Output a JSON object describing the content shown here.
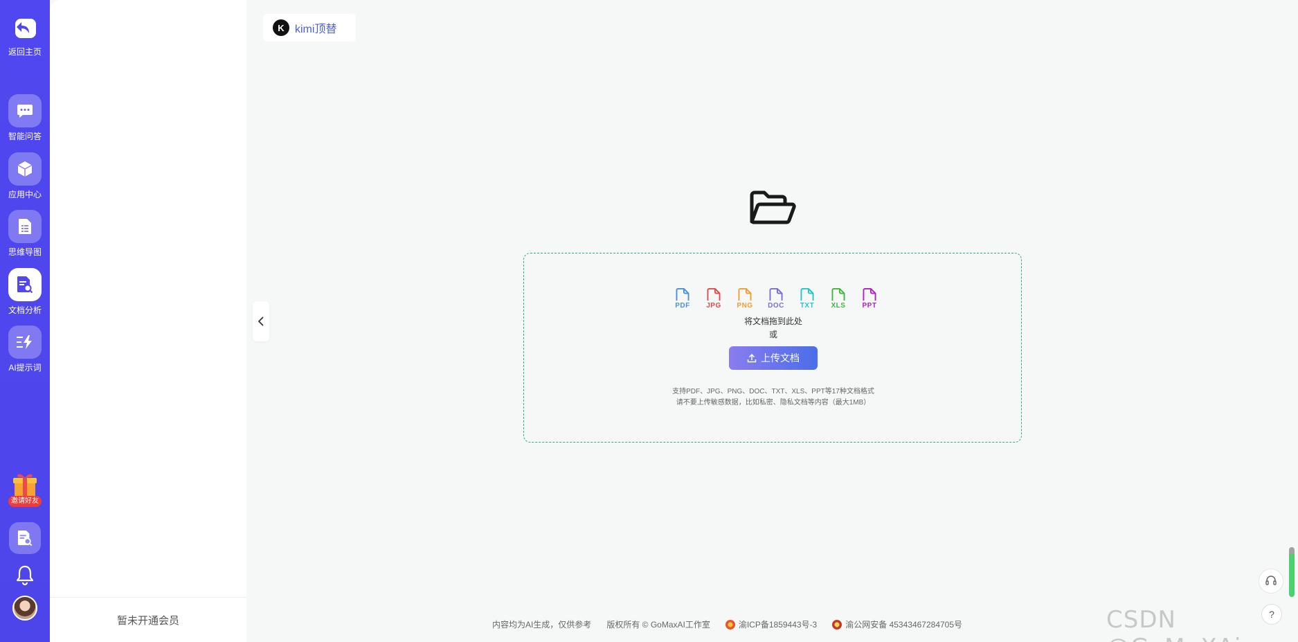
{
  "rail": {
    "home_label": "返回主页",
    "items": [
      {
        "label": "智能问答",
        "icon": "chat-bubble-icon"
      },
      {
        "label": "应用中心",
        "icon": "cube-icon"
      },
      {
        "label": "思维导图",
        "icon": "mindmap-doc-icon"
      },
      {
        "label": "文档分析",
        "icon": "doc-search-icon",
        "active": true
      },
      {
        "label": "AI提示词",
        "icon": "lightning-list-icon"
      }
    ],
    "invite_label": "邀请好友"
  },
  "panel": {
    "member_status": "暂未开通会员"
  },
  "header": {
    "model_chip_logo": "K",
    "model_chip_label": "kimi顶替"
  },
  "upload": {
    "file_types": [
      {
        "label": "PDF",
        "color": "#4a90e2"
      },
      {
        "label": "JPG",
        "color": "#e8474b"
      },
      {
        "label": "PNG",
        "color": "#f39c33"
      },
      {
        "label": "DOC",
        "color": "#7b6cd9"
      },
      {
        "label": "TXT",
        "color": "#1ec8c8"
      },
      {
        "label": "XLS",
        "color": "#3cb83c"
      },
      {
        "label": "PPT",
        "color": "#b020c8"
      }
    ],
    "drag_text": "将文档拖到此处",
    "or_text": "或",
    "button_label": "上传文档",
    "support_line1": "支持PDF、JPG、PNG、DOC、TXT、XLS、PPT等17种文档格式",
    "support_line2": "请不要上传敏感数据，比如私密、隐私文档等内容（最大1MB）"
  },
  "footer": {
    "disclaimer": "内容均为AI生成，仅供参考",
    "copyright": "版权所有 © GoMaxAI工作室",
    "icp": "渝ICP备1859443号-3",
    "police": "渝公网安备 45343467284705号"
  },
  "watermark": "CSDN @GoMaXAi",
  "colors": {
    "rail_bg": "#5147f0",
    "accent_blue": "#4c5fd6",
    "dropzone_border": "#2ab07c"
  }
}
